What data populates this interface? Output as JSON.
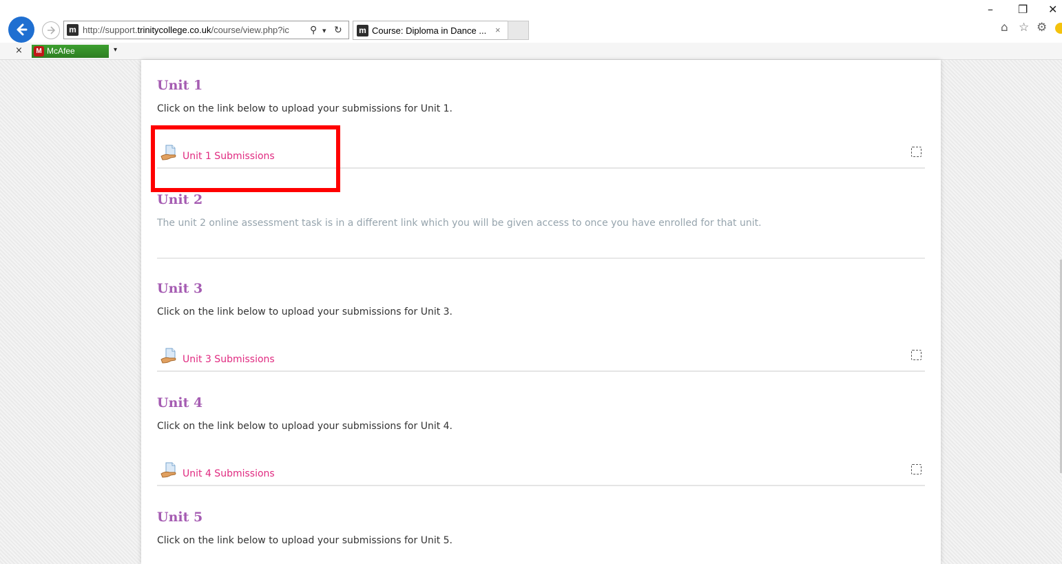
{
  "browser": {
    "url_prefix": "http://support.",
    "url_domain": "trinitycollege.co.uk",
    "url_path": "/course/view.php?ic",
    "tab_title": "Course: Diploma in Dance ...",
    "tab_close": "×",
    "site_favicon_letter": "m",
    "search_icon": "⚲",
    "dropdown_icon": "▾",
    "refresh_icon": "↻",
    "window_controls": {
      "minimize": "–",
      "restore": "❐",
      "close": "✕"
    },
    "toolbar_icons": {
      "home": "⌂",
      "favorites": "☆",
      "settings": "⚙"
    },
    "favorites_bar": {
      "close_label": "×",
      "mcafee_logo_letter": "M",
      "mcafee_label": "McAfee",
      "dropdown": "▾"
    }
  },
  "course": {
    "sections": [
      {
        "title": "Unit 1",
        "summary": "Click on the link below to upload your submissions for Unit 1.",
        "activity": "Unit 1 Submissions"
      },
      {
        "title": "Unit 2",
        "summary": "The unit 2 online assessment task is in a different link which you will be given access to once you have enrolled for that unit."
      },
      {
        "title": "Unit 3",
        "summary": "Click on the link below to upload your submissions for Unit 3.",
        "activity": "Unit 3 Submissions"
      },
      {
        "title": "Unit 4",
        "summary": "Click on the link below to upload your submissions for Unit 4.",
        "activity": "Unit 4 Submissions"
      },
      {
        "title": "Unit 5",
        "summary": "Click on the link below to upload your submissions for Unit 5."
      }
    ]
  },
  "colors": {
    "section_title": "#a55cb2",
    "activity_link": "#e02a80",
    "highlight": "#ff0000",
    "browser_back": "#1f6fd1"
  }
}
